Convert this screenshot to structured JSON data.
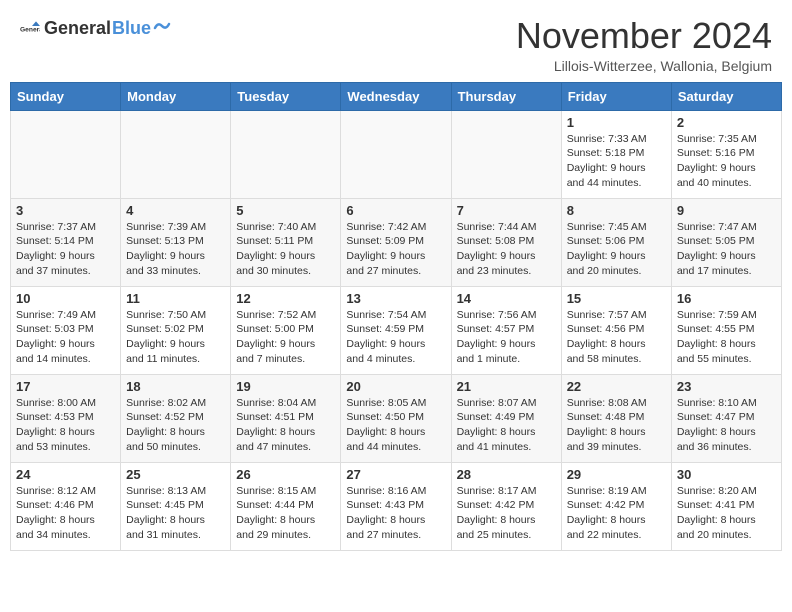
{
  "logo": {
    "text_general": "General",
    "text_blue": "Blue"
  },
  "header": {
    "month_title": "November 2024",
    "location": "Lillois-Witterzee, Wallonia, Belgium"
  },
  "days_of_week": [
    "Sunday",
    "Monday",
    "Tuesday",
    "Wednesday",
    "Thursday",
    "Friday",
    "Saturday"
  ],
  "weeks": [
    {
      "row_class": "row-odd",
      "days": [
        {
          "num": "",
          "info": "",
          "empty": true
        },
        {
          "num": "",
          "info": "",
          "empty": true
        },
        {
          "num": "",
          "info": "",
          "empty": true
        },
        {
          "num": "",
          "info": "",
          "empty": true
        },
        {
          "num": "",
          "info": "",
          "empty": true
        },
        {
          "num": "1",
          "info": "Sunrise: 7:33 AM\nSunset: 5:18 PM\nDaylight: 9 hours and 44 minutes.",
          "empty": false
        },
        {
          "num": "2",
          "info": "Sunrise: 7:35 AM\nSunset: 5:16 PM\nDaylight: 9 hours and 40 minutes.",
          "empty": false
        }
      ]
    },
    {
      "row_class": "row-even",
      "days": [
        {
          "num": "3",
          "info": "Sunrise: 7:37 AM\nSunset: 5:14 PM\nDaylight: 9 hours and 37 minutes.",
          "empty": false
        },
        {
          "num": "4",
          "info": "Sunrise: 7:39 AM\nSunset: 5:13 PM\nDaylight: 9 hours and 33 minutes.",
          "empty": false
        },
        {
          "num": "5",
          "info": "Sunrise: 7:40 AM\nSunset: 5:11 PM\nDaylight: 9 hours and 30 minutes.",
          "empty": false
        },
        {
          "num": "6",
          "info": "Sunrise: 7:42 AM\nSunset: 5:09 PM\nDaylight: 9 hours and 27 minutes.",
          "empty": false
        },
        {
          "num": "7",
          "info": "Sunrise: 7:44 AM\nSunset: 5:08 PM\nDaylight: 9 hours and 23 minutes.",
          "empty": false
        },
        {
          "num": "8",
          "info": "Sunrise: 7:45 AM\nSunset: 5:06 PM\nDaylight: 9 hours and 20 minutes.",
          "empty": false
        },
        {
          "num": "9",
          "info": "Sunrise: 7:47 AM\nSunset: 5:05 PM\nDaylight: 9 hours and 17 minutes.",
          "empty": false
        }
      ]
    },
    {
      "row_class": "row-odd",
      "days": [
        {
          "num": "10",
          "info": "Sunrise: 7:49 AM\nSunset: 5:03 PM\nDaylight: 9 hours and 14 minutes.",
          "empty": false
        },
        {
          "num": "11",
          "info": "Sunrise: 7:50 AM\nSunset: 5:02 PM\nDaylight: 9 hours and 11 minutes.",
          "empty": false
        },
        {
          "num": "12",
          "info": "Sunrise: 7:52 AM\nSunset: 5:00 PM\nDaylight: 9 hours and 7 minutes.",
          "empty": false
        },
        {
          "num": "13",
          "info": "Sunrise: 7:54 AM\nSunset: 4:59 PM\nDaylight: 9 hours and 4 minutes.",
          "empty": false
        },
        {
          "num": "14",
          "info": "Sunrise: 7:56 AM\nSunset: 4:57 PM\nDaylight: 9 hours and 1 minute.",
          "empty": false
        },
        {
          "num": "15",
          "info": "Sunrise: 7:57 AM\nSunset: 4:56 PM\nDaylight: 8 hours and 58 minutes.",
          "empty": false
        },
        {
          "num": "16",
          "info": "Sunrise: 7:59 AM\nSunset: 4:55 PM\nDaylight: 8 hours and 55 minutes.",
          "empty": false
        }
      ]
    },
    {
      "row_class": "row-even",
      "days": [
        {
          "num": "17",
          "info": "Sunrise: 8:00 AM\nSunset: 4:53 PM\nDaylight: 8 hours and 53 minutes.",
          "empty": false
        },
        {
          "num": "18",
          "info": "Sunrise: 8:02 AM\nSunset: 4:52 PM\nDaylight: 8 hours and 50 minutes.",
          "empty": false
        },
        {
          "num": "19",
          "info": "Sunrise: 8:04 AM\nSunset: 4:51 PM\nDaylight: 8 hours and 47 minutes.",
          "empty": false
        },
        {
          "num": "20",
          "info": "Sunrise: 8:05 AM\nSunset: 4:50 PM\nDaylight: 8 hours and 44 minutes.",
          "empty": false
        },
        {
          "num": "21",
          "info": "Sunrise: 8:07 AM\nSunset: 4:49 PM\nDaylight: 8 hours and 41 minutes.",
          "empty": false
        },
        {
          "num": "22",
          "info": "Sunrise: 8:08 AM\nSunset: 4:48 PM\nDaylight: 8 hours and 39 minutes.",
          "empty": false
        },
        {
          "num": "23",
          "info": "Sunrise: 8:10 AM\nSunset: 4:47 PM\nDaylight: 8 hours and 36 minutes.",
          "empty": false
        }
      ]
    },
    {
      "row_class": "row-odd",
      "days": [
        {
          "num": "24",
          "info": "Sunrise: 8:12 AM\nSunset: 4:46 PM\nDaylight: 8 hours and 34 minutes.",
          "empty": false
        },
        {
          "num": "25",
          "info": "Sunrise: 8:13 AM\nSunset: 4:45 PM\nDaylight: 8 hours and 31 minutes.",
          "empty": false
        },
        {
          "num": "26",
          "info": "Sunrise: 8:15 AM\nSunset: 4:44 PM\nDaylight: 8 hours and 29 minutes.",
          "empty": false
        },
        {
          "num": "27",
          "info": "Sunrise: 8:16 AM\nSunset: 4:43 PM\nDaylight: 8 hours and 27 minutes.",
          "empty": false
        },
        {
          "num": "28",
          "info": "Sunrise: 8:17 AM\nSunset: 4:42 PM\nDaylight: 8 hours and 25 minutes.",
          "empty": false
        },
        {
          "num": "29",
          "info": "Sunrise: 8:19 AM\nSunset: 4:42 PM\nDaylight: 8 hours and 22 minutes.",
          "empty": false
        },
        {
          "num": "30",
          "info": "Sunrise: 8:20 AM\nSunset: 4:41 PM\nDaylight: 8 hours and 20 minutes.",
          "empty": false
        }
      ]
    }
  ]
}
